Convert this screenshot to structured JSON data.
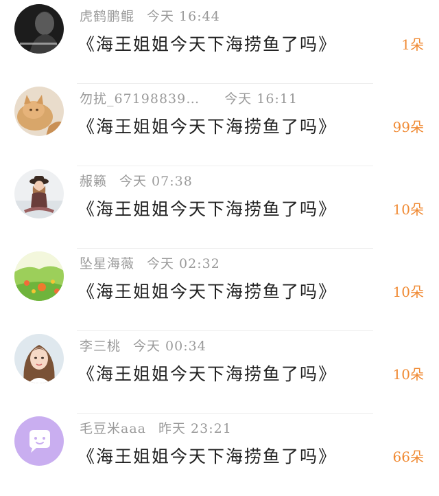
{
  "comments": [
    {
      "name": "虎鹤鹏鲲",
      "time": "今天 16:44",
      "message": "《海王姐姐今天下海捞鱼了吗》",
      "count": "1朵",
      "avatar_icon": "dark-portrait-avatar"
    },
    {
      "name": "勿扰_67198839…",
      "time": "今天 16:11",
      "message": "《海王姐姐今天下海捞鱼了吗》",
      "count": "99朵",
      "avatar_icon": "cat-avatar"
    },
    {
      "name": "赧籁",
      "time": "今天 07:38",
      "message": "《海王姐姐今天下海捞鱼了吗》",
      "count": "10朵",
      "avatar_icon": "girl-with-hat-avatar"
    },
    {
      "name": "坠星海薇",
      "time": "今天 02:32",
      "message": "《海王姐姐今天下海捞鱼了吗》",
      "count": "10朵",
      "avatar_icon": "flower-field-avatar"
    },
    {
      "name": "李三桃",
      "time": "今天 00:34",
      "message": "《海王姐姐今天下海捞鱼了吗》",
      "count": "10朵",
      "avatar_icon": "woman-portrait-avatar"
    },
    {
      "name": "毛豆米aaa",
      "time": "昨天 23:21",
      "message": "《海王姐姐今天下海捞鱼了吗》",
      "count": "66朵",
      "avatar_icon": "chat-bubble-avatar"
    }
  ],
  "colors": {
    "name": "#9a9a9a",
    "message": "#222222",
    "count": "#f08a33",
    "separator": "#ededed",
    "default_avatar": "#c9aef0"
  }
}
